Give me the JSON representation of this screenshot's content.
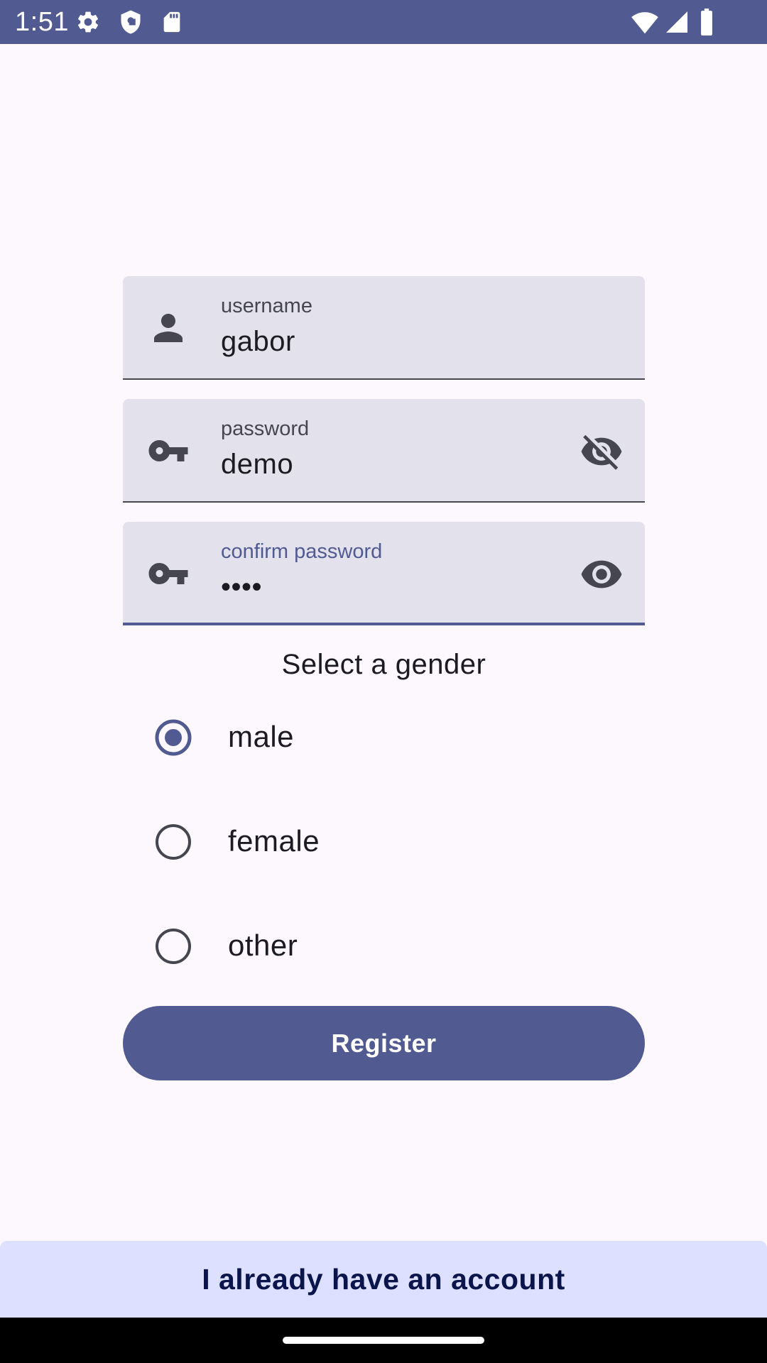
{
  "status_bar": {
    "time": "1:51",
    "background_color": "#515B92",
    "left_icons": [
      "gear-icon",
      "shield-icon",
      "sd-card-icon"
    ],
    "right_icons": [
      "wifi-icon",
      "cellular-signal-icon",
      "battery-icon"
    ]
  },
  "form": {
    "username": {
      "label": "username",
      "value": "gabor",
      "leading_icon": "person-icon"
    },
    "password": {
      "label": "password",
      "value": "demo",
      "leading_icon": "key-icon",
      "trailing_icon": "visibility-off-icon"
    },
    "confirm_password": {
      "label": "confirm password",
      "value": "••••",
      "leading_icon": "key-icon",
      "trailing_icon": "visibility-icon",
      "focused": true
    }
  },
  "gender": {
    "title": "Select a gender",
    "selected": "male",
    "options": [
      {
        "label": "male",
        "selected": true
      },
      {
        "label": "female",
        "selected": false
      },
      {
        "label": "other",
        "selected": false
      }
    ]
  },
  "actions": {
    "register_label": "Register",
    "already_account_label": "I already have an account"
  },
  "colors": {
    "primary": "#515B92",
    "background": "#FCF8FD",
    "field_background": "#E3E1EC",
    "secondary_container": "#DEE0FF",
    "on_secondary_container": "#0A154B"
  }
}
